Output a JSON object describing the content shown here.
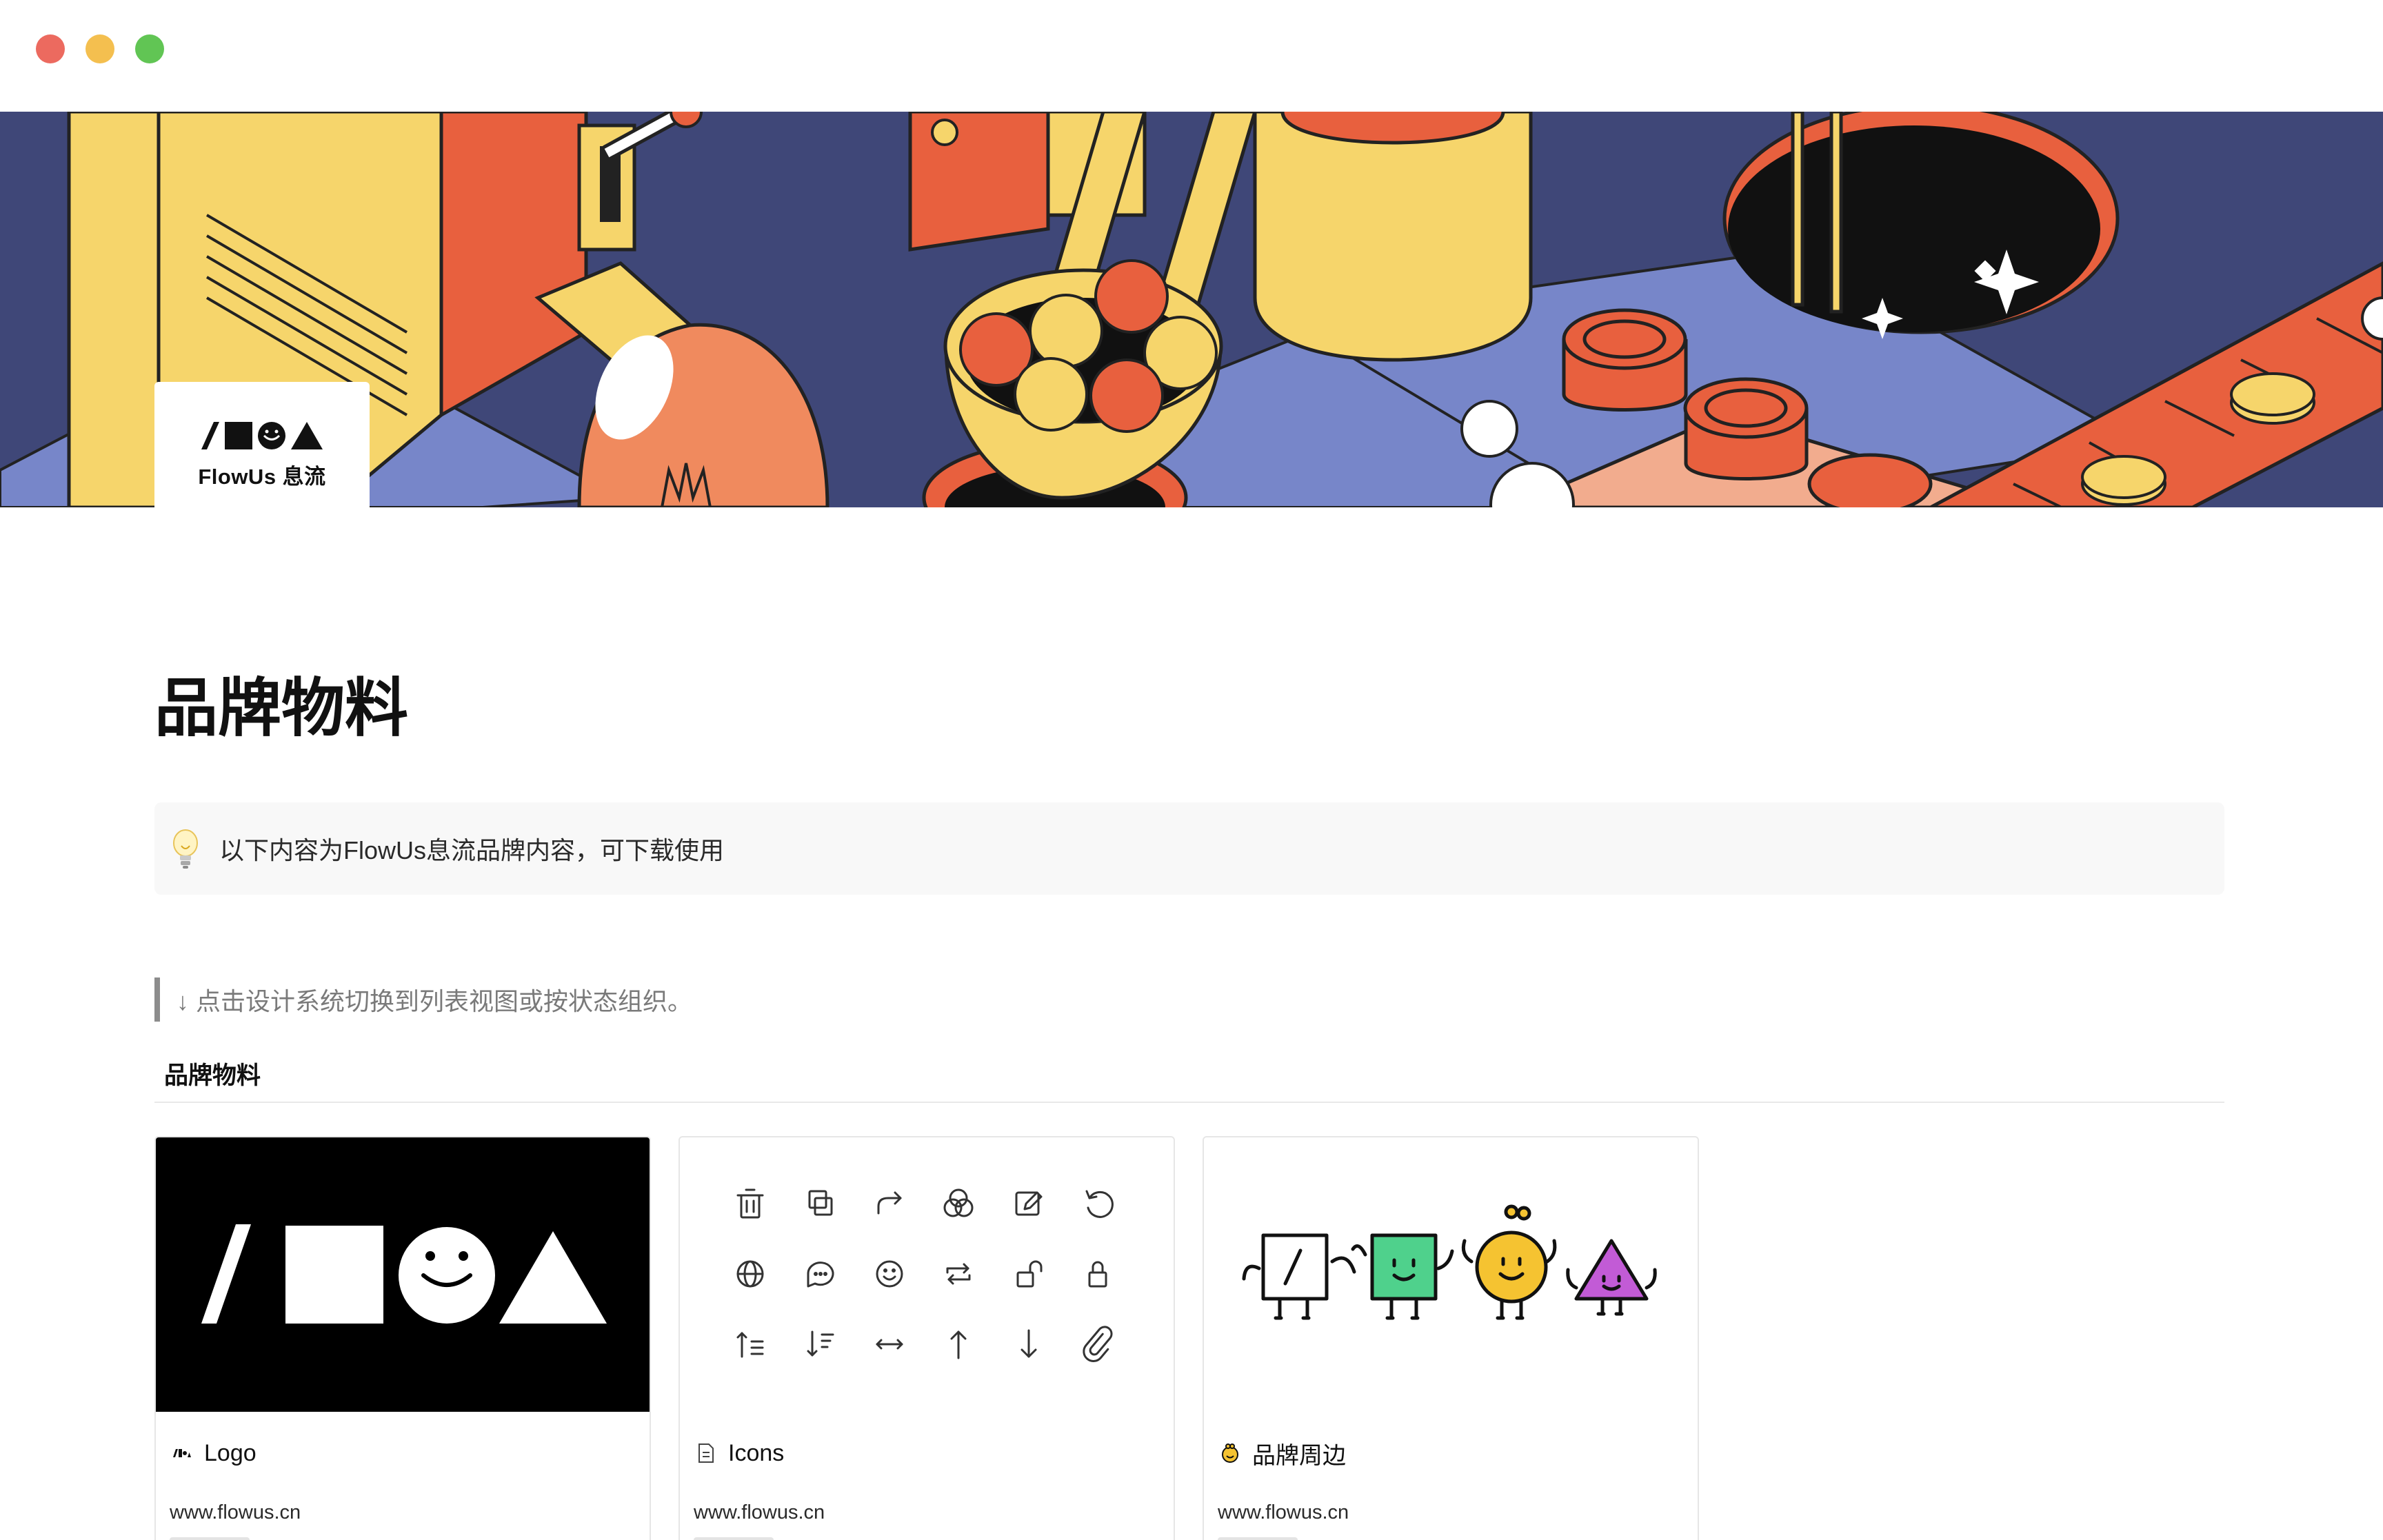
{
  "window": {
    "controls": [
      "close",
      "minimize",
      "maximize"
    ]
  },
  "page_icon": {
    "brand_text": "FlowUs 息流"
  },
  "page": {
    "title": "品牌物料",
    "callout": {
      "icon": "lightbulb-icon",
      "text": "以下内容为FlowUs息流品牌内容，可下载使用"
    },
    "quote": "↓ 点击设计系统切换到列表视图或按状态组织。"
  },
  "gallery": {
    "title": "品牌物料",
    "cards": [
      {
        "title": "Logo",
        "icon": "logo-icon",
        "url": "www.flowus.cn"
      },
      {
        "title": "Icons",
        "icon": "document-icon",
        "url": "www.flowus.cn"
      },
      {
        "title": "品牌周边",
        "icon": "face-icon",
        "url": "www.flowus.cn"
      }
    ]
  },
  "icon_grid": [
    [
      "trash-icon",
      "copy-icon",
      "redo-icon",
      "venn-icon",
      "edit-icon",
      "undo-icon"
    ],
    [
      "globe-icon",
      "comment-icon",
      "smile-icon",
      "repeat-icon",
      "unlock-icon",
      "lock-icon"
    ],
    [
      "sort-asc-icon",
      "sort-desc-icon",
      "swap-horizontal-icon",
      "arrow-up-icon",
      "arrow-down-icon",
      "paperclip-icon"
    ]
  ],
  "colors": {
    "cover_navy": "#3f4778",
    "cover_periwinkle": "#7786c9",
    "cover_yellow": "#f6d56b",
    "cover_orange": "#e8603e",
    "callout_bg": "#f8f8f8",
    "quote_border": "#8c8c8c",
    "mascot_green": "#4fd18c",
    "mascot_yellow": "#f5c331",
    "mascot_purple": "#c25bd6"
  }
}
